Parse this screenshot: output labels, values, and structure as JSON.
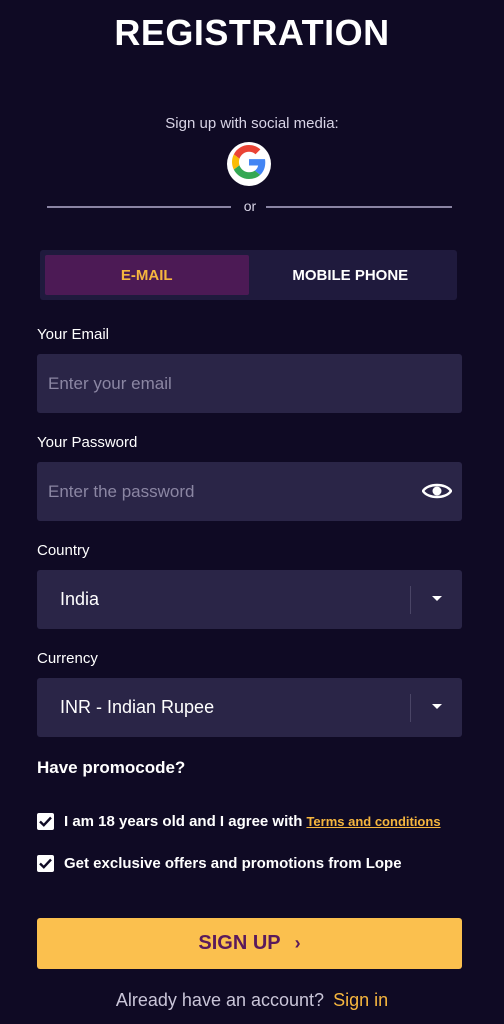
{
  "page": {
    "title": "REGISTRATION",
    "social_caption": "Sign up with social media:",
    "divider_text": "or"
  },
  "social": {
    "google_icon": "google-icon"
  },
  "tabs": [
    {
      "label": "E-MAIL",
      "active": true
    },
    {
      "label": "MOBILE PHONE",
      "active": false
    }
  ],
  "form": {
    "email": {
      "label": "Your Email",
      "placeholder": "Enter your email",
      "value": ""
    },
    "password": {
      "label": "Your Password",
      "placeholder": "Enter the password",
      "value": "",
      "toggle_icon": "eye-icon"
    },
    "country": {
      "label": "Country",
      "value": "India",
      "arrow_icon": "caret-down-icon"
    },
    "currency": {
      "label": "Currency",
      "value": "INR - Indian Rupee",
      "arrow_icon": "caret-down-icon"
    }
  },
  "promo": {
    "label": "Have promocode?"
  },
  "checks": {
    "age": {
      "label": "I am 18 years old and I agree with",
      "link": "Terms and conditions",
      "checked": true
    },
    "offers": {
      "label": "Get exclusive offers and promotions from Lope",
      "checked": true
    }
  },
  "signup": {
    "label": "SIGN UP",
    "chevron": "›"
  },
  "signin": {
    "text": "Already have an account?",
    "link": "Sign in"
  },
  "colors": {
    "background": "#0f0a24",
    "field": "#2a2547",
    "accent": "#f6b63e",
    "button": "#fbc04e",
    "button_text": "#5a1a5c",
    "active_tab": "#4c1a55"
  }
}
